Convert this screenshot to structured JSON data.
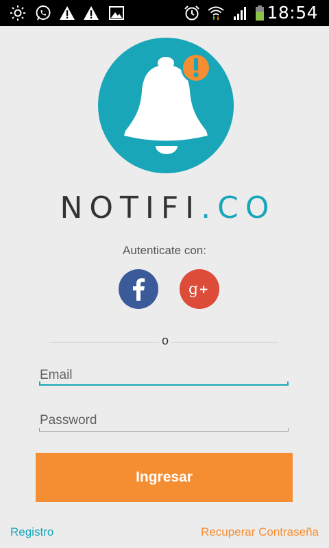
{
  "status_bar": {
    "time": "18:54",
    "icons": [
      "brightness-icon",
      "whatsapp-icon",
      "warning-icon",
      "warning-icon",
      "image-icon",
      "alarm-icon",
      "wifi-icon",
      "signal-icon",
      "battery-icon"
    ]
  },
  "logo": {
    "brand_main": "NOTIFI",
    "brand_dot": ".",
    "brand_suffix": "CO",
    "icon": "bell-icon",
    "badge_icon": "exclamation-badge-icon"
  },
  "auth": {
    "label": "Autenticate con:",
    "facebook_icon": "facebook-icon",
    "google_plus_icon": "google-plus-icon"
  },
  "divider": {
    "text": "o"
  },
  "form": {
    "email_placeholder": "Email",
    "email_value": "",
    "password_placeholder": "Password",
    "password_value": "",
    "submit_label": "Ingresar"
  },
  "footer": {
    "register_label": "Registro",
    "recover_label": "Recuperar Contraseña"
  },
  "colors": {
    "accent": "#19a6b9",
    "primary_button": "#f58e32",
    "facebook": "#3b5a9a",
    "google_plus": "#dd4b39",
    "background": "#ececec"
  }
}
